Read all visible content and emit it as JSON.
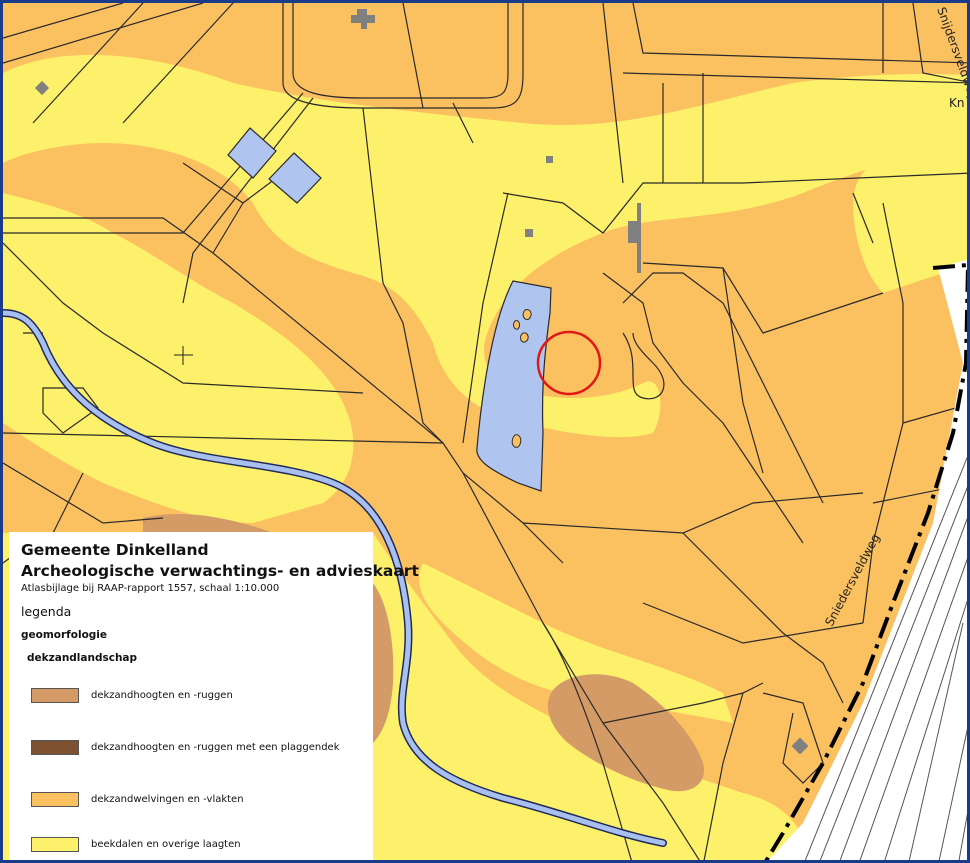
{
  "map": {
    "street_labels": [
      "Snijdersveldweg",
      "Kn",
      "Sniedersveldweg"
    ],
    "colors": {
      "dekzandhoogten": "#d49b67",
      "plaggendek": "#7e5230",
      "welvingen": "#fbc060",
      "beekdalen": "#fdf06a",
      "water": "#b0c4f0",
      "stream": "#a8bff0",
      "building": "#808080",
      "highlight_circle": "#e01818",
      "frame": "#1a3a8a"
    }
  },
  "legend": {
    "title_line1": "Gemeente Dinkelland",
    "title_line2": "Archeologische verwachtings- en advieskaart",
    "subtitle": "Atlasbijlage bij RAAP-rapport 1557, schaal 1:10.000",
    "heading": "legenda",
    "section": "geomorfologie",
    "subsection": "dekzandlandschap",
    "items": [
      {
        "label": "dekzandhoogten en -ruggen",
        "color": "#d49b67"
      },
      {
        "label": "dekzandhoogten en -ruggen met een plaggendek",
        "color": "#7e5230"
      },
      {
        "label": "dekzandwelvingen en -vlakten",
        "color": "#fbc060"
      },
      {
        "label": "beekdalen en overige laagten",
        "color": "#fdf06a"
      }
    ]
  }
}
